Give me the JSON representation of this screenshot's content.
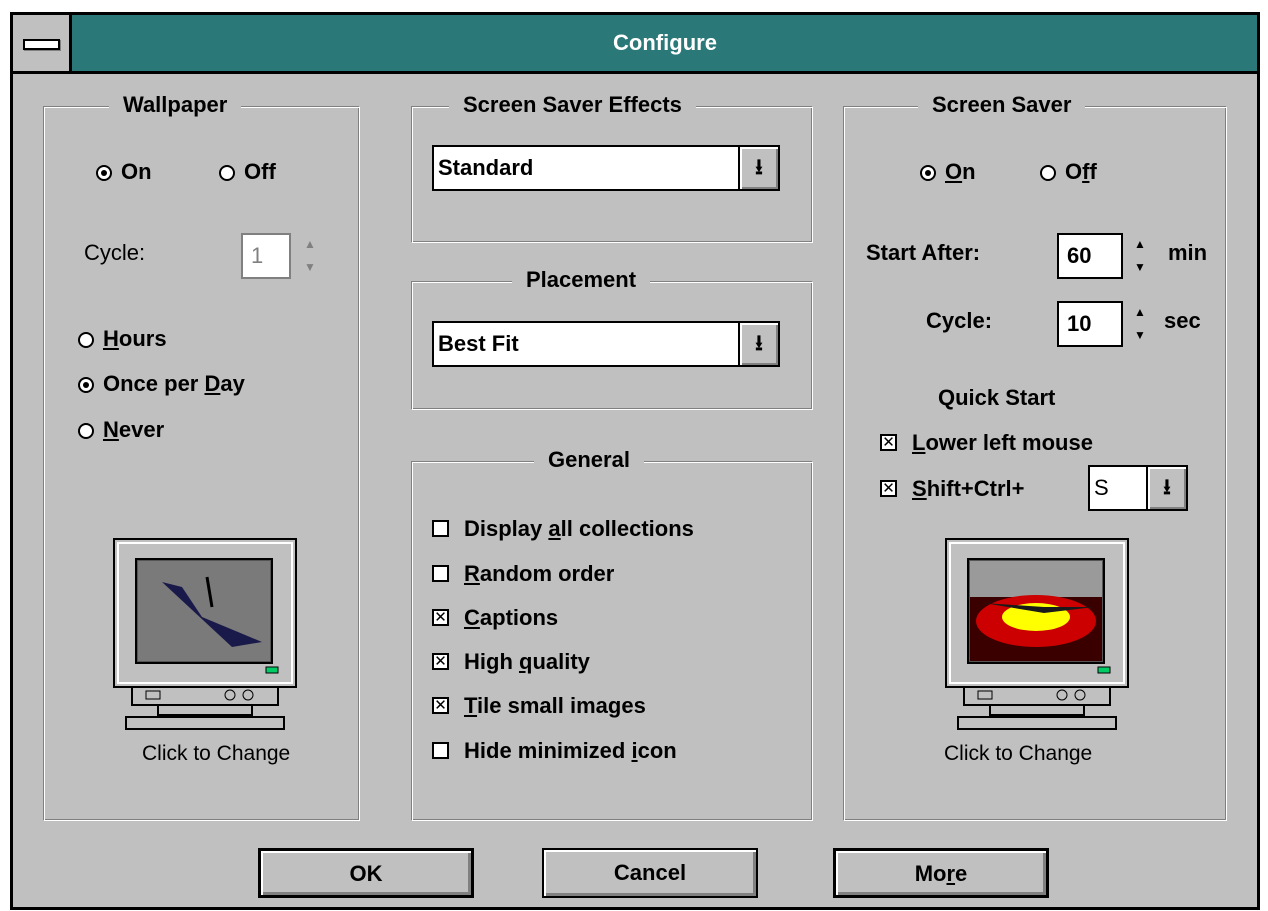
{
  "window": {
    "title": "Configure"
  },
  "wallpaper": {
    "legend": "Wallpaper",
    "on_label": "On",
    "off_label": "Off",
    "on_selected": true,
    "cycle_label": "Cycle:",
    "cycle_value": "1",
    "hours_label": "Hours",
    "once_label": "Once per Day",
    "never_label": "Never",
    "selected_frequency": "Once per Day",
    "click_caption": "Click to Change"
  },
  "effects": {
    "legend": "Screen Saver Effects",
    "value": "Standard"
  },
  "placement": {
    "legend": "Placement",
    "value": "Best Fit"
  },
  "general": {
    "legend": "General",
    "items": [
      {
        "label": "Display all collections",
        "checked": false
      },
      {
        "label": "Random order",
        "checked": false
      },
      {
        "label": "Captions",
        "checked": true
      },
      {
        "label": "High quality",
        "checked": true
      },
      {
        "label": "Tile small images",
        "checked": true
      },
      {
        "label": "Hide minimized icon",
        "checked": false
      }
    ]
  },
  "screensaver": {
    "legend": "Screen Saver",
    "on_label": "On",
    "off_label": "Off",
    "on_selected": true,
    "start_after_label": "Start After:",
    "start_after_value": "60",
    "start_after_unit": "min",
    "cycle_label": "Cycle:",
    "cycle_value": "10",
    "cycle_unit": "sec",
    "quick_start_label": "Quick Start",
    "lower_left_label": "Lower left mouse",
    "lower_left_checked": true,
    "shift_ctrl_label": "Shift+Ctrl+",
    "shift_ctrl_checked": true,
    "shift_ctrl_key": "S",
    "click_caption": "Click to Change"
  },
  "buttons": {
    "ok": "OK",
    "cancel": "Cancel",
    "more": "More"
  },
  "icons": {
    "dropdown": "dropdown-arrow-icon",
    "spinner": "spinner-icon",
    "sysmenu": "system-menu-icon"
  }
}
